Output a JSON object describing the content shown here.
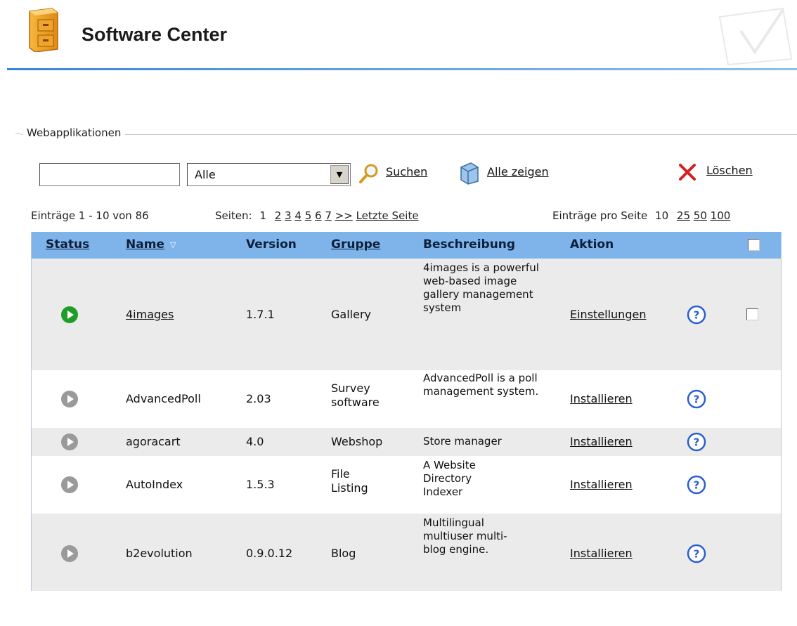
{
  "header": {
    "title": "Software Center"
  },
  "fieldset": {
    "legend": "Webapplikationen"
  },
  "toolbar": {
    "search_value": "",
    "group_selected": "Alle",
    "search_label": "Suchen",
    "show_all_label": "Alle zeigen",
    "delete_label": "Löschen"
  },
  "pager": {
    "entries_label": "Einträge 1 - 10 von 86",
    "pages_label": "Seiten:",
    "pages": [
      "1",
      "2",
      "3",
      "4",
      "5",
      "6",
      "7",
      ">>"
    ],
    "last_page_label": "Letzte Seite",
    "per_page_label": "Einträge pro Seite",
    "per_page_options": [
      "10",
      "25",
      "50",
      "100"
    ]
  },
  "table": {
    "headers": {
      "status": "Status",
      "name": "Name",
      "version": "Version",
      "group": "Gruppe",
      "description": "Beschreibung",
      "action": "Aktion"
    },
    "rows": [
      {
        "status": "active",
        "name": "4images",
        "version": "1.7.1",
        "group": "Gallery",
        "description": "4images is a powerful web-based image gallery management system",
        "action": "Einstellungen"
      },
      {
        "status": "inactive",
        "name": "AdvancedPoll",
        "version": "2.03",
        "group": "Survey software",
        "description": "AdvancedPoll is a poll management system.",
        "action": "Installieren"
      },
      {
        "status": "inactive",
        "name": "agoracart",
        "version": "4.0",
        "group": "Webshop",
        "description": "Store manager",
        "action": "Installieren"
      },
      {
        "status": "inactive",
        "name": "AutoIndex",
        "version": "1.5.3",
        "group": "File Listing",
        "description": "A Website Directory Indexer",
        "action": "Installieren"
      },
      {
        "status": "inactive",
        "name": "b2evolution",
        "version": "0.9.0.12",
        "group": "Blog",
        "description": "Multilingual multiuser multi-blog engine.",
        "action": "Installieren"
      }
    ]
  },
  "colors": {
    "header_rule": "#3a86d8",
    "table_header_bg": "#7eb4ea",
    "status_active": "#1e9e28",
    "status_inactive": "#9a9a9a",
    "delete_red": "#d42020",
    "help_blue": "#2a5fd0"
  }
}
